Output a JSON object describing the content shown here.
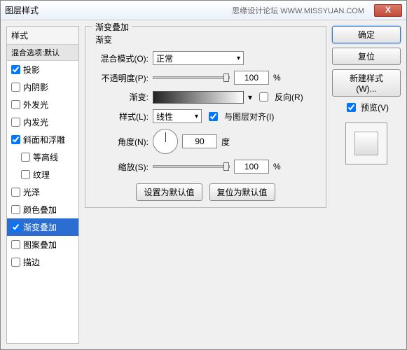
{
  "window": {
    "title": "图层样式",
    "watermark": "思缘设计论坛  WWW.MISSYUAN.COM",
    "close": "X"
  },
  "left": {
    "header": "样式",
    "sub": "混合选项:默认",
    "items": [
      {
        "label": "投影",
        "checked": true
      },
      {
        "label": "内阴影",
        "checked": false
      },
      {
        "label": "外发光",
        "checked": false
      },
      {
        "label": "内发光",
        "checked": false
      },
      {
        "label": "斜面和浮雕",
        "checked": true
      },
      {
        "label": "等高线",
        "checked": false,
        "indent": true
      },
      {
        "label": "纹理",
        "checked": false,
        "indent": true
      },
      {
        "label": "光泽",
        "checked": false
      },
      {
        "label": "颜色叠加",
        "checked": false
      },
      {
        "label": "渐变叠加",
        "checked": true,
        "selected": true
      },
      {
        "label": "图案叠加",
        "checked": false
      },
      {
        "label": "描边",
        "checked": false
      }
    ]
  },
  "center": {
    "group_title": "渐变叠加",
    "sub_title": "渐变",
    "blend_label": "混合模式(O):",
    "blend_value": "正常",
    "opacity_label": "不透明度(P):",
    "opacity_value": "100",
    "percent": "%",
    "gradient_label": "渐变:",
    "reverse_label": "反向(R)",
    "reverse_checked": false,
    "style_label": "样式(L):",
    "style_value": "线性",
    "align_label": "与图层对齐(I)",
    "align_checked": true,
    "angle_label": "角度(N):",
    "angle_value": "90",
    "angle_unit": "度",
    "scale_label": "缩放(S):",
    "scale_value": "100",
    "btn_default": "设置为默认值",
    "btn_reset": "复位为默认值"
  },
  "right": {
    "ok": "确定",
    "cancel": "复位",
    "new_style": "新建样式(W)...",
    "preview_label": "预览(V)",
    "preview_checked": true
  }
}
